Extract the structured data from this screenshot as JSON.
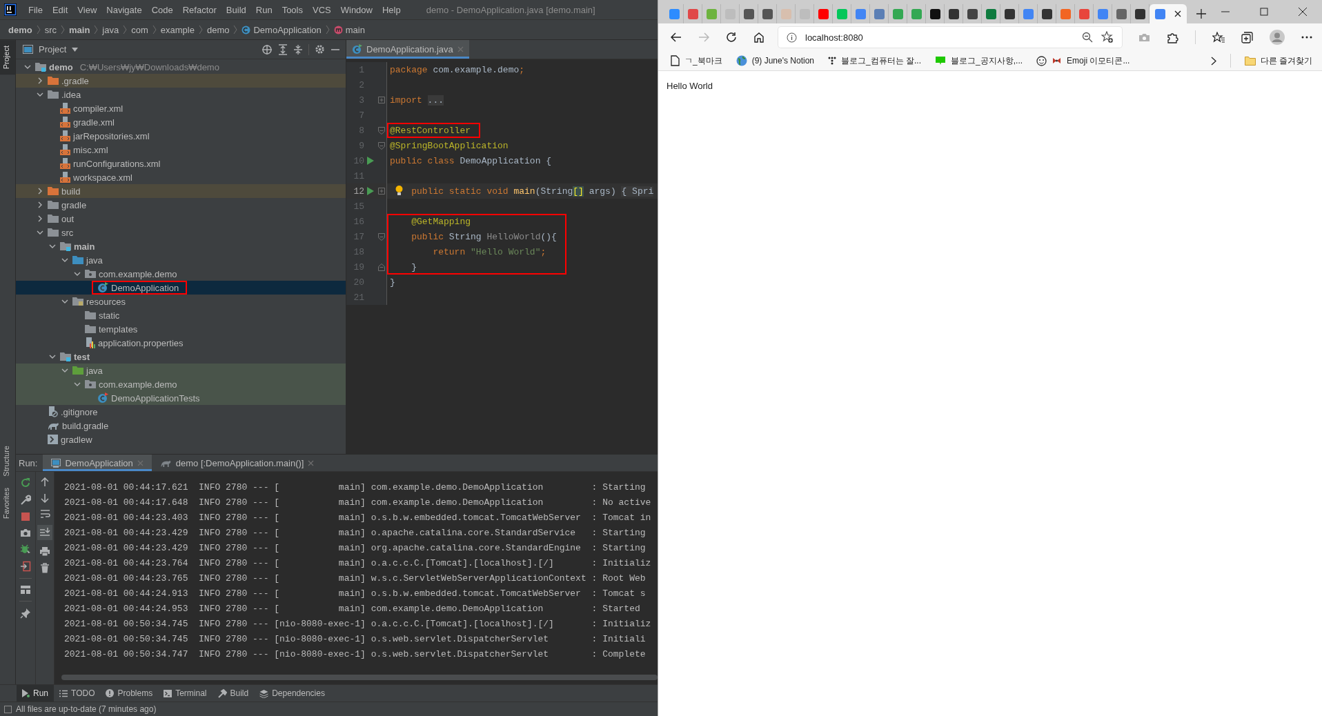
{
  "ide": {
    "menu": [
      "File",
      "Edit",
      "View",
      "Navigate",
      "Code",
      "Refactor",
      "Build",
      "Run",
      "Tools",
      "VCS",
      "Window",
      "Help"
    ],
    "title": "demo - DemoApplication.java [demo.main]",
    "breadcrumbs": [
      {
        "label": "demo",
        "module": true,
        "kind": "folder"
      },
      {
        "label": "src",
        "module": false,
        "kind": "folder"
      },
      {
        "label": "main",
        "module": true,
        "kind": "folder"
      },
      {
        "label": "java",
        "module": false,
        "kind": "folder"
      },
      {
        "label": "com",
        "module": false,
        "kind": "folder"
      },
      {
        "label": "example",
        "module": false,
        "kind": "folder"
      },
      {
        "label": "demo",
        "module": false,
        "kind": "folder"
      },
      {
        "label": "DemoApplication",
        "module": false,
        "kind": "class"
      },
      {
        "label": "main",
        "module": false,
        "kind": "method"
      }
    ],
    "side_tabs": [
      {
        "label": "Project",
        "selected": true
      },
      {
        "label": "Structure",
        "selected": false
      },
      {
        "label": "Favorites",
        "selected": false
      }
    ],
    "project": {
      "title": "Project",
      "tree": [
        {
          "label": "demo",
          "path": "C:₩Users₩jy₩Downloads₩demo",
          "kind": "module",
          "expanded": true,
          "selected": false,
          "children": [
            {
              "label": ".gradle",
              "kind": "excluded",
              "expanded": false,
              "selected": false
            },
            {
              "label": ".idea",
              "kind": "folder",
              "expanded": true,
              "selected": false,
              "children": [
                {
                  "label": "compiler.xml",
                  "kind": "xml",
                  "selected": false
                },
                {
                  "label": "gradle.xml",
                  "kind": "xml",
                  "selected": false
                },
                {
                  "label": "jarRepositories.xml",
                  "kind": "xml",
                  "selected": false
                },
                {
                  "label": "misc.xml",
                  "kind": "xml",
                  "selected": false
                },
                {
                  "label": "runConfigurations.xml",
                  "kind": "xml",
                  "selected": false
                },
                {
                  "label": "workspace.xml",
                  "kind": "xml",
                  "selected": false
                }
              ]
            },
            {
              "label": "build",
              "kind": "excluded",
              "expanded": false,
              "selected": false
            },
            {
              "label": "gradle",
              "kind": "folder",
              "expanded": false,
              "selected": false
            },
            {
              "label": "out",
              "kind": "folder",
              "expanded": false,
              "selected": false
            },
            {
              "label": "src",
              "kind": "folder",
              "expanded": true,
              "selected": false,
              "children": [
                {
                  "label": "main",
                  "kind": "module",
                  "expanded": true,
                  "selected": false,
                  "children": [
                    {
                      "label": "java",
                      "kind": "source",
                      "expanded": true,
                      "selected": false,
                      "children": [
                        {
                          "label": "com.example.demo",
                          "kind": "package",
                          "expanded": true,
                          "selected": false,
                          "children": [
                            {
                              "label": "DemoApplication",
                              "kind": "class",
                              "selected": true,
                              "marked": true
                            }
                          ]
                        }
                      ]
                    },
                    {
                      "label": "resources",
                      "kind": "resources",
                      "expanded": true,
                      "selected": false,
                      "children": [
                        {
                          "label": "static",
                          "kind": "folder",
                          "selected": false
                        },
                        {
                          "label": "templates",
                          "kind": "folder",
                          "selected": false
                        },
                        {
                          "label": "application.properties",
                          "kind": "properties",
                          "selected": false
                        }
                      ]
                    }
                  ]
                },
                {
                  "label": "test",
                  "kind": "module",
                  "expanded": true,
                  "selected": false,
                  "children": [
                    {
                      "label": "java",
                      "kind": "test-source",
                      "expanded": true,
                      "selected": false,
                      "test_scope": true,
                      "children": [
                        {
                          "label": "com.example.demo",
                          "kind": "package",
                          "expanded": true,
                          "selected": false,
                          "test_scope": true,
                          "children": [
                            {
                              "label": "DemoApplicationTests",
                              "kind": "class",
                              "selected": false,
                              "test_scope": true
                            }
                          ]
                        }
                      ]
                    }
                  ]
                }
              ]
            },
            {
              "label": ".gitignore",
              "kind": "ignore",
              "selected": false
            },
            {
              "label": "build.gradle",
              "kind": "gradle",
              "selected": false
            },
            {
              "label": "gradlew",
              "kind": "script",
              "selected": false
            }
          ]
        }
      ]
    },
    "editor": {
      "tabs": [
        {
          "label": "DemoApplication.java",
          "selected": true
        }
      ],
      "lines": [
        {
          "num": "1",
          "tokens": [
            {
              "t": "package ",
              "kind": "kw"
            },
            {
              "t": "com.example.demo",
              "kind": "plain"
            },
            {
              "t": ";",
              "kind": "kw"
            }
          ]
        },
        {
          "num": "2"
        },
        {
          "num": "3",
          "fold": {
            "kind": "plus"
          },
          "tokens": [
            {
              "t": "import ",
              "kind": "kw"
            },
            {
              "t": "...",
              "kind": "fold"
            }
          ]
        },
        {
          "num": "7"
        },
        {
          "num": "8",
          "fold": {
            "kind": "open"
          },
          "boxed": true,
          "tokens": [
            {
              "t": "@RestController",
              "kind": "ann"
            }
          ]
        },
        {
          "num": "9",
          "fold": {
            "kind": "open"
          },
          "tokens": [
            {
              "t": "@SpringBootApplication",
              "kind": "ann"
            }
          ]
        },
        {
          "num": "10",
          "run": true,
          "tokens": [
            {
              "t": "public class ",
              "kind": "kw"
            },
            {
              "t": "DemoApplication {",
              "kind": "plain"
            }
          ]
        },
        {
          "num": "11"
        },
        {
          "num": "12",
          "run": true,
          "fold": {
            "kind": "plus"
          },
          "current": true,
          "bulb": true,
          "tokens": [
            {
              "t": "    public static void ",
              "kind": "kw"
            },
            {
              "t": "main",
              "kind": "fn"
            },
            {
              "t": "(String",
              "kind": "plain"
            },
            {
              "t": "[]",
              "kind": "match"
            },
            {
              "t": " args) ",
              "kind": "plain"
            },
            {
              "t": "{ Spri",
              "kind": "fold"
            }
          ]
        },
        {
          "num": "15"
        },
        {
          "num": "16",
          "boxed": true,
          "tokens": [
            {
              "t": "    @GetMapping",
              "kind": "ann"
            }
          ]
        },
        {
          "num": "17",
          "fold": {
            "kind": "open"
          },
          "boxed": true,
          "tokens": [
            {
              "t": "    public ",
              "kind": "kw"
            },
            {
              "t": "String ",
              "kind": "plain"
            },
            {
              "t": "HelloWorld",
              "kind": "dim"
            },
            {
              "t": "(){",
              "kind": "plain"
            }
          ]
        },
        {
          "num": "18",
          "boxed": true,
          "tokens": [
            {
              "t": "        return ",
              "kind": "kw"
            },
            {
              "t": "\"Hello World\"",
              "kind": "str"
            },
            {
              "t": ";",
              "kind": "kw"
            }
          ]
        },
        {
          "num": "19",
          "fold": {
            "kind": "close"
          },
          "boxed": true,
          "tokens": [
            {
              "t": "    }",
              "kind": "plain"
            }
          ]
        },
        {
          "num": "20",
          "tokens": [
            {
              "t": "}",
              "kind": "plain"
            }
          ]
        },
        {
          "num": "21"
        }
      ]
    },
    "run": {
      "title": "Run:",
      "tabs": [
        {
          "label": "DemoApplication",
          "selected": true
        },
        {
          "label": "demo [:DemoApplication.main()]",
          "selected": false
        }
      ],
      "log": [
        "2021-08-01 00:44:17.621  INFO 2780 --- [           main] com.example.demo.DemoApplication         : Starting",
        "2021-08-01 00:44:17.648  INFO 2780 --- [           main] com.example.demo.DemoApplication         : No active",
        "2021-08-01 00:44:23.403  INFO 2780 --- [           main] o.s.b.w.embedded.tomcat.TomcatWebServer  : Tomcat in",
        "2021-08-01 00:44:23.429  INFO 2780 --- [           main] o.apache.catalina.core.StandardService   : Starting",
        "2021-08-01 00:44:23.429  INFO 2780 --- [           main] org.apache.catalina.core.StandardEngine  : Starting",
        "2021-08-01 00:44:23.764  INFO 2780 --- [           main] o.a.c.c.C.[Tomcat].[localhost].[/]       : Initializ",
        "2021-08-01 00:44:23.765  INFO 2780 --- [           main] w.s.c.ServletWebServerApplicationContext : Root Web",
        "2021-08-01 00:44:24.913  INFO 2780 --- [           main] o.s.b.w.embedded.tomcat.TomcatWebServer  : Tomcat s",
        "2021-08-01 00:44:24.953  INFO 2780 --- [           main] com.example.demo.DemoApplication         : Started",
        "2021-08-01 00:50:34.745  INFO 2780 --- [nio-8080-exec-1] o.a.c.c.C.[Tomcat].[localhost].[/]       : Initializ",
        "2021-08-01 00:50:34.745  INFO 2780 --- [nio-8080-exec-1] o.s.web.servlet.DispatcherServlet        : Initiali",
        "2021-08-01 00:50:34.747  INFO 2780 --- [nio-8080-exec-1] o.s.web.servlet.DispatcherServlet        : Complete"
      ]
    },
    "tool_tabs": [
      {
        "label": "Run",
        "kind": "run",
        "selected": true
      },
      {
        "label": "TODO",
        "kind": "list",
        "selected": false
      },
      {
        "label": "Problems",
        "kind": "problems",
        "selected": false
      },
      {
        "label": "Terminal",
        "kind": "terminal",
        "selected": false
      },
      {
        "label": "Build",
        "kind": "build",
        "selected": false
      },
      {
        "label": "Dependencies",
        "kind": "deps",
        "selected": false
      }
    ],
    "status": "All files are up-to-date (7 minutes ago)"
  },
  "browser": {
    "tabs": [
      {
        "color": "#2d8cff",
        "selected": false
      },
      {
        "color": "#e04848",
        "selected": false
      },
      {
        "color": "#6db33f",
        "selected": false
      },
      {
        "color": "#bdbdbd",
        "selected": false
      },
      {
        "color": "#555555",
        "selected": false
      },
      {
        "color": "#555555",
        "selected": false
      },
      {
        "color": "#d8bfae",
        "selected": false
      },
      {
        "color": "#bdbdbd",
        "selected": false
      },
      {
        "color": "#ff0000",
        "selected": false
      },
      {
        "color": "#03c75a",
        "selected": false
      },
      {
        "color": "#4285f4",
        "selected": false
      },
      {
        "color": "#5b7fb5",
        "selected": false
      },
      {
        "color": "#34a853",
        "selected": false
      },
      {
        "color": "#34a853",
        "selected": false
      },
      {
        "color": "#111111",
        "selected": false
      },
      {
        "color": "#333333",
        "selected": false
      },
      {
        "color": "#444444",
        "selected": false
      },
      {
        "color": "#0f7b3f",
        "selected": false
      },
      {
        "color": "#333333",
        "selected": false
      },
      {
        "color": "#4285f4",
        "selected": false
      },
      {
        "color": "#333333",
        "selected": false
      },
      {
        "color": "#f26522",
        "selected": false
      },
      {
        "color": "#e8453c",
        "selected": false
      },
      {
        "color": "#4285f4",
        "selected": false
      },
      {
        "color": "#666666",
        "selected": false
      },
      {
        "color": "#333333",
        "selected": false
      },
      {
        "color": "#4285f4",
        "selected": true
      }
    ],
    "address": "localhost:8080",
    "bookmarks": [
      {
        "label": "ㄱ_북마크",
        "kind": "page"
      },
      {
        "label": "(9) June's Notion",
        "kind": "globe"
      },
      {
        "label": "블로그_컴퓨터는 잘...",
        "kind": "dots"
      },
      {
        "label": "블로그_공지사항,...",
        "kind": "blog"
      },
      {
        "label": "Emoji 이모티콘...",
        "kind": "emoji"
      }
    ],
    "other_bookmarks": "다른 즐겨찾기",
    "content": "Hello World"
  }
}
